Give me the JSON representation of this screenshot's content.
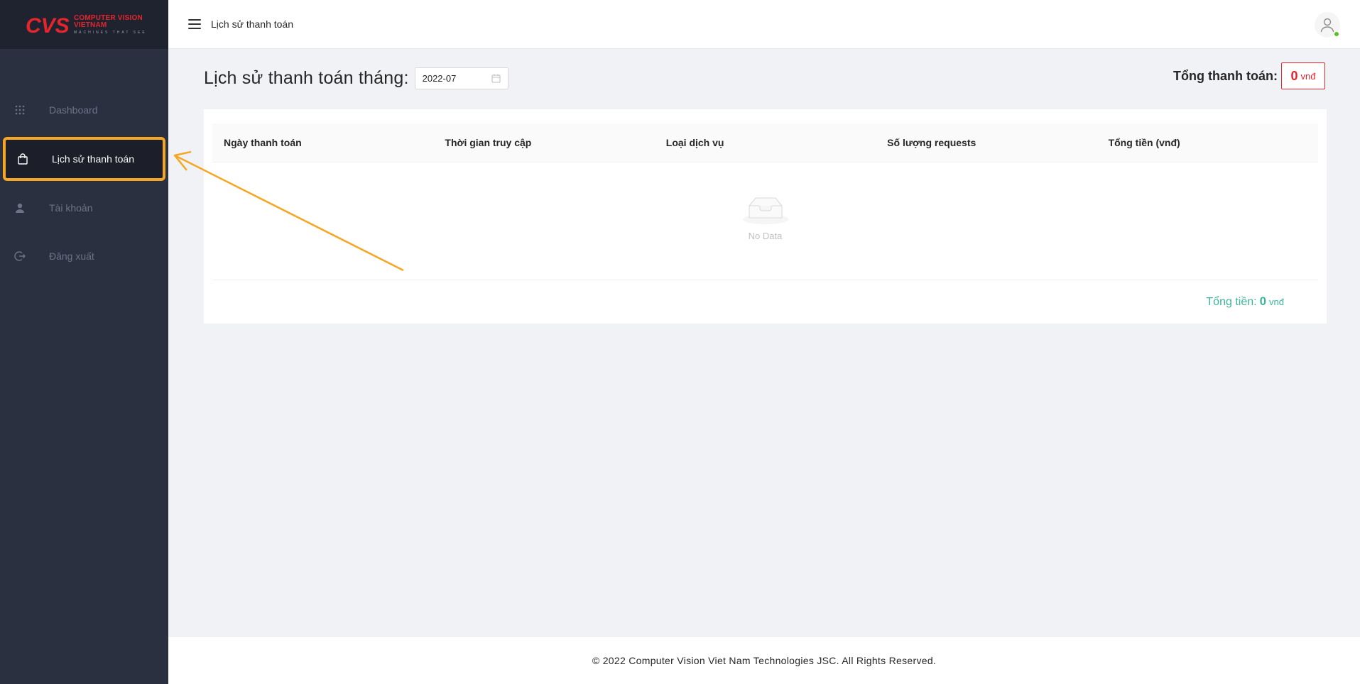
{
  "brand": {
    "logo_mark": "CVS",
    "name_line1": "COMPUTER VISION",
    "name_line2": "VIETNAM",
    "tagline": "MACHINES THAT SEE",
    "color": "#e4262c"
  },
  "sidebar": {
    "items": [
      {
        "label": "Dashboard",
        "icon": "grid-dots-icon"
      },
      {
        "label": "Lịch sử thanh toán",
        "icon": "shopping-bag-icon",
        "active": true
      },
      {
        "label": "Tài khoản",
        "icon": "user-icon"
      },
      {
        "label": "Đăng xuất",
        "icon": "logout-icon"
      }
    ]
  },
  "header": {
    "title": "Lịch sử thanh toán"
  },
  "main": {
    "page_title": "Lịch sử thanh toán tháng:",
    "month_value": "2022-07",
    "total_label": "Tổng thanh toán:",
    "total_value": "0",
    "total_unit": "vnđ",
    "table": {
      "columns": [
        "Ngày thanh toán",
        "Thời gian truy cập",
        "Loại dịch vụ",
        "Số lượng requests",
        "Tổng tiền (vnđ)"
      ],
      "rows": [],
      "empty_text": "No Data"
    },
    "sum_label": "Tổng tiền:",
    "sum_value": "0",
    "sum_unit": "vnđ"
  },
  "footer": {
    "copyright": "© 2022 Computer Vision Viet Nam Technologies JSC. All Rights Reserved."
  },
  "colors": {
    "sidebar_bg": "#2b3040",
    "highlight": "#f5a623",
    "accent_red": "#e4262c",
    "accent_green": "#3cb59b"
  }
}
